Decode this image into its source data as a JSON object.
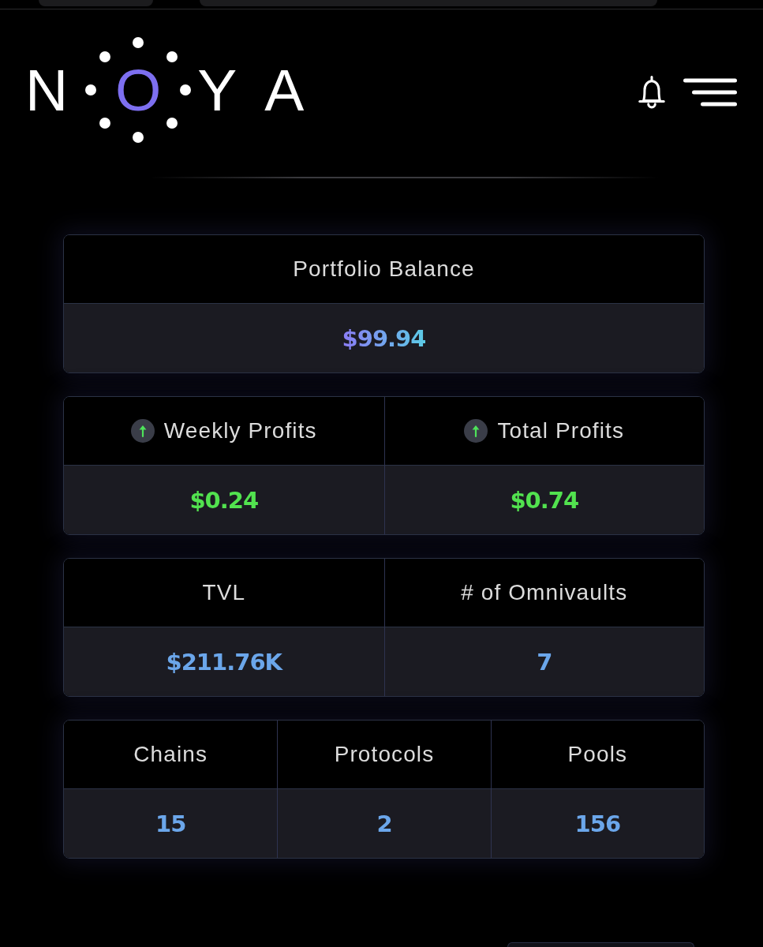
{
  "header": {
    "logo_letters": [
      "N",
      "O",
      "Y",
      "A"
    ]
  },
  "cards": [
    {
      "cells": [
        {
          "kind": "balance",
          "label": "Portfolio Balance",
          "value": "$99.94"
        }
      ]
    },
    {
      "cells": [
        {
          "kind": "profit",
          "label": "Weekly Profits",
          "value": "$0.24"
        },
        {
          "kind": "profit",
          "label": "Total Profits",
          "value": "$0.74"
        }
      ]
    },
    {
      "cells": [
        {
          "kind": "stat",
          "label": "TVL",
          "value": "$211.76K"
        },
        {
          "kind": "stat",
          "label": "# of Omnivaults",
          "value": "7"
        }
      ]
    },
    {
      "cells": [
        {
          "kind": "stat",
          "label": "Chains",
          "value": "15"
        },
        {
          "kind": "stat",
          "label": "Protocols",
          "value": "2"
        },
        {
          "kind": "stat",
          "label": "Pools",
          "value": "156"
        }
      ]
    }
  ]
}
